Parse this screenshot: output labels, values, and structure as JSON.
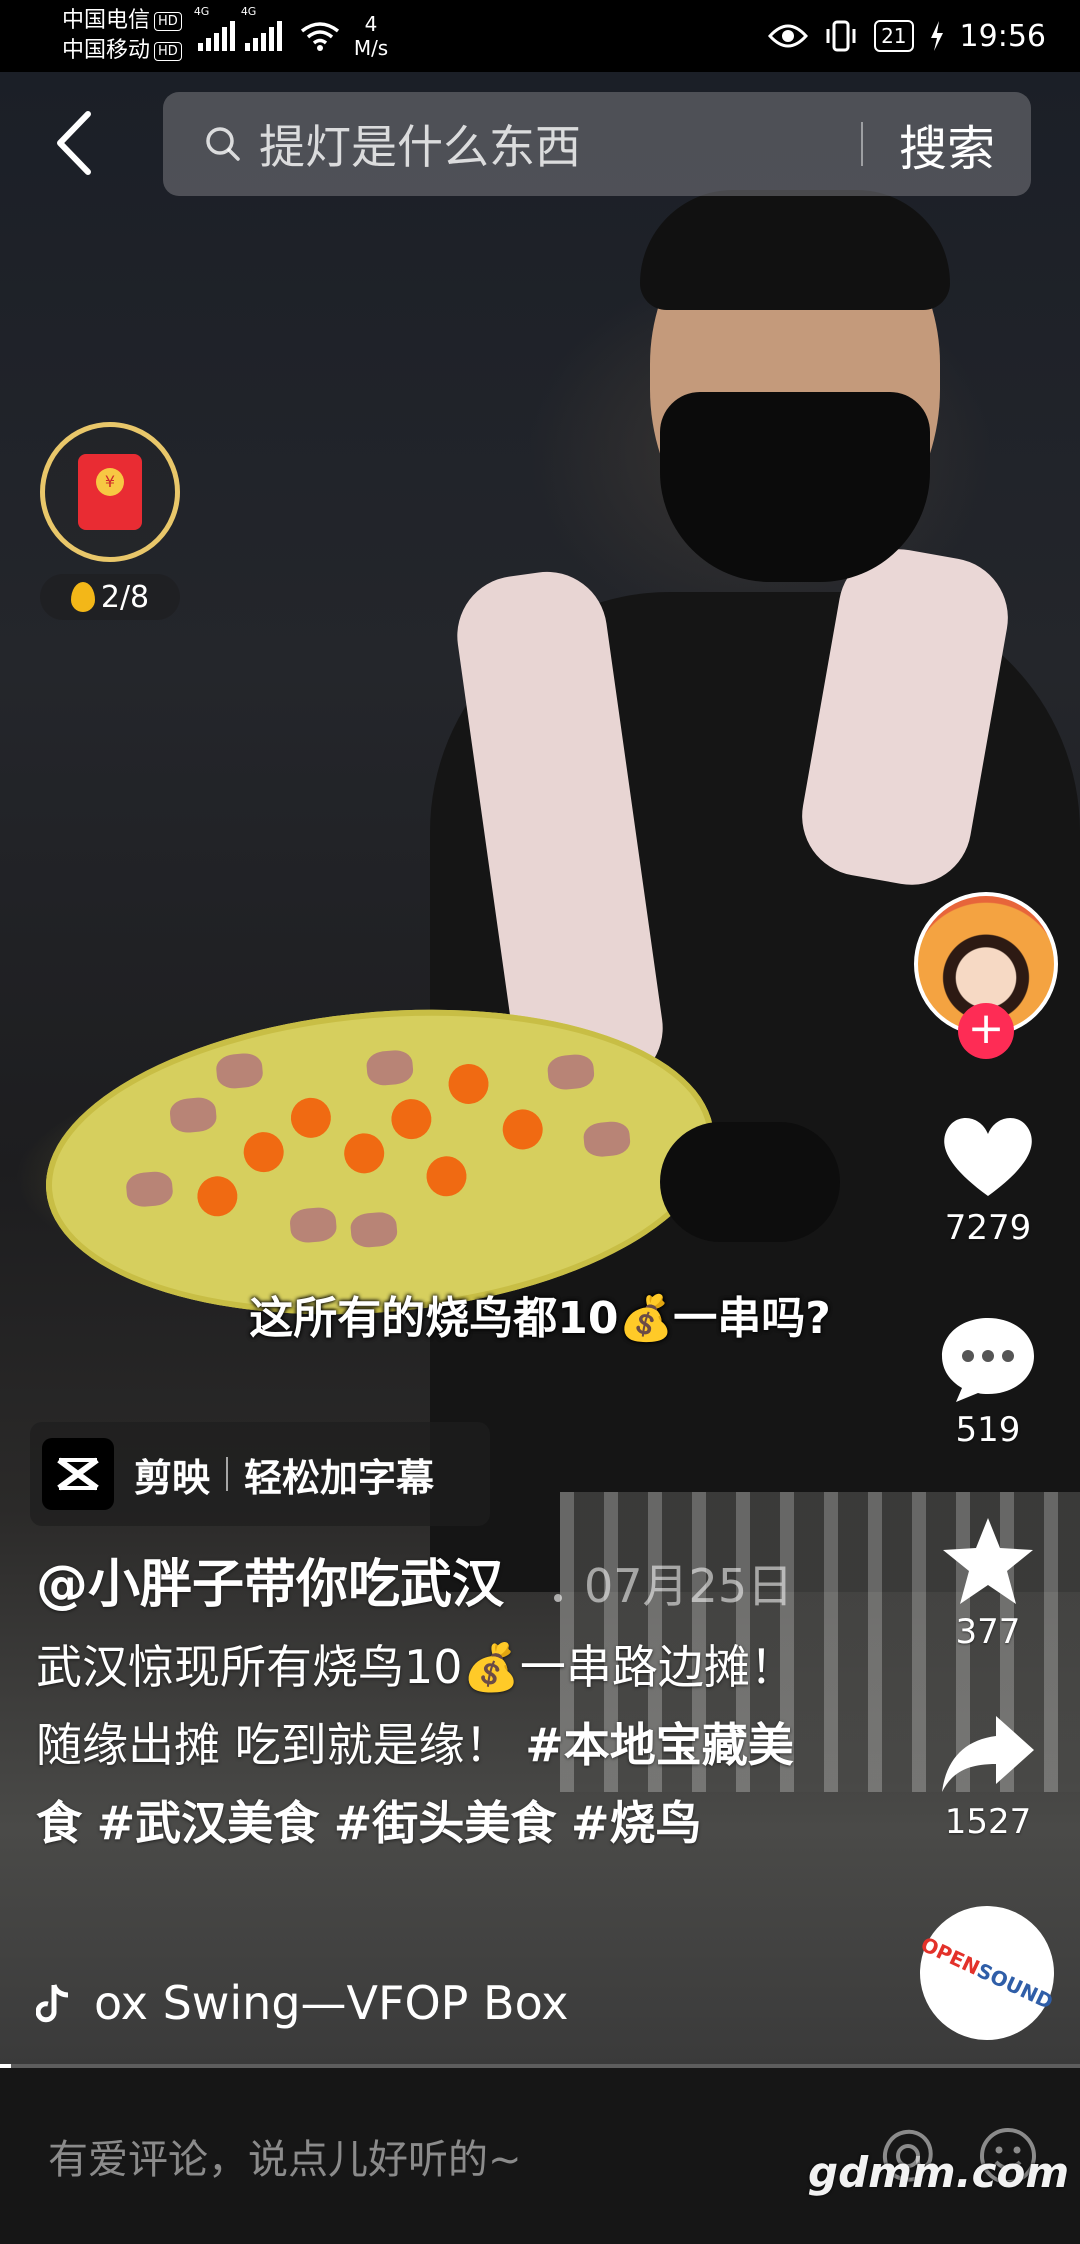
{
  "status_bar": {
    "carrier1": "中国电信",
    "carrier2": "中国移动",
    "hd_badge": "HD",
    "net_type": "4G",
    "speed_value": "4",
    "speed_unit": "M/s",
    "battery": "21",
    "time": "19:56"
  },
  "search": {
    "query": "提灯是什么东西",
    "button_label": "搜索"
  },
  "red_packet": {
    "progress": "2/8"
  },
  "rail": {
    "likes": "7279",
    "comments": "519",
    "favorites": "377",
    "shares": "1527"
  },
  "video": {
    "subtitle_part1": "这所有的烧鸟都10",
    "subtitle_part2": "一串吗?",
    "capcut_app": "剪映",
    "capcut_action": "轻松加字幕"
  },
  "post": {
    "author": "@小胖子带你吃武汉",
    "date": "07月25日",
    "desc_part1": "武汉惊现所有烧鸟10",
    "desc_part2": "一串路边摊！ 随缘出摊 吃到就是缘！",
    "hashtags": [
      "#本地宝藏美食",
      "#武汉美食",
      "#街头美食",
      "#烧鸟"
    ],
    "music": "ox Swing—VFOP    Box"
  },
  "comment_bar": {
    "placeholder": "有爱评论，说点儿好听的~"
  },
  "watermark": "gdmm.com",
  "disc_label": {
    "a": "OPEN",
    "b": "SOUND"
  },
  "progress": 0.01,
  "colors": {
    "follow_accent": "#fe2c55",
    "packet_ring": "#e9c76a",
    "packet_red": "#e92c33"
  }
}
